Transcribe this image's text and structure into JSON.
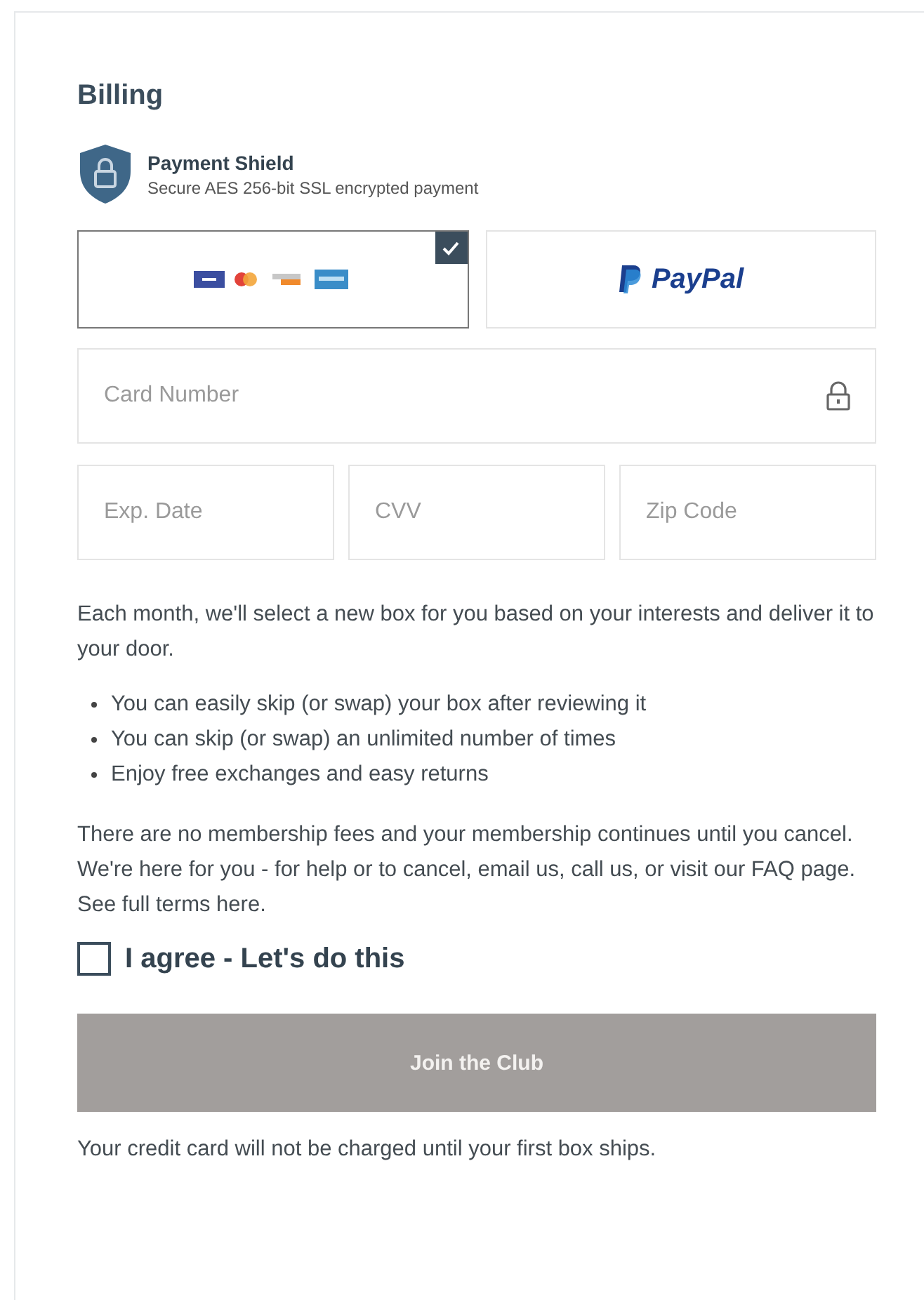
{
  "title": "Billing",
  "shield": {
    "title": "Payment Shield",
    "subtitle": "Secure AES 256-bit SSL encrypted payment"
  },
  "payment_options": [
    {
      "kind": "cards",
      "selected": true
    },
    {
      "kind": "paypal",
      "label": "PayPal",
      "selected": false
    }
  ],
  "fields": [
    {
      "placeholder": "Card Number",
      "lock": true
    },
    {
      "placeholder": "Exp. Date",
      "lock": false
    },
    {
      "placeholder": "CVV",
      "lock": false
    },
    {
      "placeholder": "Zip Code",
      "lock": false
    }
  ],
  "intro": "Each month, we'll select a new box for you based on your interests and deliver it to your door.",
  "bullets": [
    "You can easily skip (or swap) your box after reviewing it",
    "You can skip (or swap) an unlimited number of times",
    "Enjoy free exchanges and easy returns"
  ],
  "terms": "There are no membership fees and your membership continues until you cancel. We're here for you - for help or to cancel, email us, call us, or visit our FAQ page. See full terms here.",
  "agree": {
    "label": "I agree - Let's do this",
    "checked": false
  },
  "submit": {
    "label": "Join the Club",
    "disabled": true
  },
  "note": "Your credit card will not be charged until your first box ships."
}
